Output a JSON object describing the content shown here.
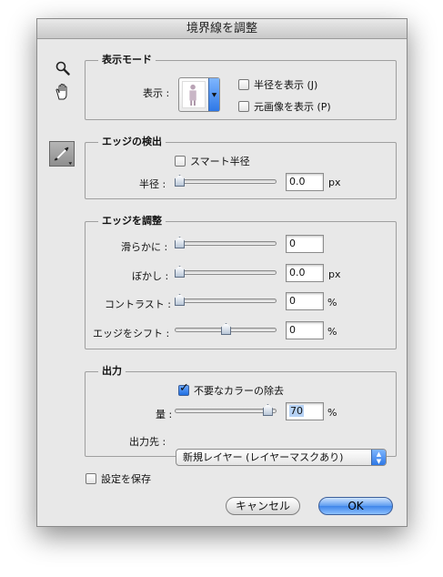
{
  "window": {
    "title": "境界線を調整"
  },
  "tools": {
    "zoom": "zoom-icon",
    "hand": "hand-icon",
    "refine": "refine-radius-brush-icon"
  },
  "view_mode": {
    "title": "表示モード",
    "view_label": "表示 :",
    "show_radius": {
      "label": "半径を表示 (J)",
      "checked": false
    },
    "show_original": {
      "label": "元画像を表示 (P)",
      "checked": false
    }
  },
  "edge_detection": {
    "title": "エッジの検出",
    "smart_radius": {
      "label": "スマート半径",
      "checked": false
    },
    "radius": {
      "label": "半径 :",
      "value": "0.0",
      "unit": "px",
      "slider_fraction": 0.0
    }
  },
  "adjust_edge": {
    "title": "エッジを調整",
    "smooth": {
      "label": "滑らかに :",
      "value": "0",
      "slider_fraction": 0.0
    },
    "feather": {
      "label": "ぼかし :",
      "value": "0.0",
      "unit": "px",
      "slider_fraction": 0.0
    },
    "contrast": {
      "label": "コントラスト :",
      "value": "0",
      "unit": "%",
      "slider_fraction": 0.0
    },
    "shift_edge": {
      "label": "エッジをシフト :",
      "value": "0",
      "unit": "%",
      "slider_fraction": 0.5
    }
  },
  "output": {
    "title": "出力",
    "decontaminate": {
      "label": "不要なカラーの除去",
      "checked": true
    },
    "amount": {
      "label": "量 :",
      "value": "70",
      "unit": "%",
      "slider_fraction": 0.95
    },
    "output_to": {
      "label": "出力先 :",
      "selected": "新規レイヤー (レイヤーマスクあり)"
    }
  },
  "remember_settings": {
    "label": "設定を保存",
    "checked": false
  },
  "buttons": {
    "cancel": "キャンセル",
    "ok": "OK"
  }
}
